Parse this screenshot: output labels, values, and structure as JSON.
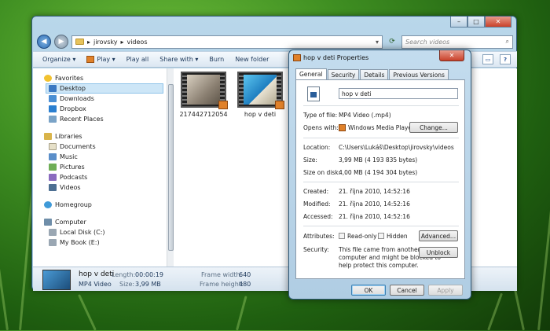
{
  "explorer": {
    "window_controls": [
      "–",
      "□",
      "✕"
    ],
    "address": {
      "path": [
        "jirovsky",
        "videos"
      ],
      "sep": "▸"
    },
    "search_placeholder": "Search videos",
    "toolbar": {
      "organize": "Organize ▾",
      "play": "Play ▾",
      "play_all": "Play all",
      "share": "Share with ▾",
      "burn": "Burn",
      "new_folder": "New folder"
    },
    "nav": {
      "favorites": "Favorites",
      "desktop": "Desktop",
      "downloads": "Downloads",
      "dropbox": "Dropbox",
      "recent": "Recent Places",
      "libraries": "Libraries",
      "documents": "Documents",
      "music": "Music",
      "pictures": "Pictures",
      "podcasts": "Podcasts",
      "videos": "Videos",
      "homegroup": "Homegroup",
      "computer": "Computer",
      "local_disk": "Local Disk (C:)",
      "mybook": "My Book (E:)"
    },
    "files": [
      {
        "name": "217442712054"
      },
      {
        "name": "hop v deti"
      }
    ],
    "details": {
      "name": "hop v deti",
      "type": "MP4 Video",
      "length_label": "Length:",
      "length": "00:00:19",
      "size_label": "Size:",
      "size": "3,99 MB",
      "fw_label": "Frame width:",
      "fw": "640",
      "fh_label": "Frame height:",
      "fh": "480"
    }
  },
  "props": {
    "title": "hop v deti Properties",
    "close": "✕",
    "tabs": [
      "General",
      "Security",
      "Details",
      "Previous Versions"
    ],
    "filename": "hop v deti",
    "type_label": "Type of file:",
    "type": "MP4 Video (.mp4)",
    "opens_label": "Opens with:",
    "opens": "Windows Media Player",
    "change": "Change...",
    "location_label": "Location:",
    "location": "C:\\Users\\Lukáš\\Desktop\\jirovsky\\videos",
    "size_label": "Size:",
    "size": "3,99 MB (4 193 835 bytes)",
    "disk_label": "Size on disk:",
    "disk": "4,00 MB (4 194 304 bytes)",
    "created_label": "Created:",
    "created": "21. října 2010, 14:52:16",
    "modified_label": "Modified:",
    "modified": "21. října 2010, 14:52:16",
    "accessed_label": "Accessed:",
    "accessed": "21. října 2010, 14:52:16",
    "attr_label": "Attributes:",
    "readonly": "Read-only",
    "hidden": "Hidden",
    "advanced": "Advanced...",
    "security_label": "Security:",
    "security_text": [
      "This file came from another",
      "computer and might be blocked to",
      "help protect this computer."
    ],
    "unblock": "Unblock",
    "ok": "OK",
    "cancel": "Cancel",
    "apply": "Apply"
  }
}
